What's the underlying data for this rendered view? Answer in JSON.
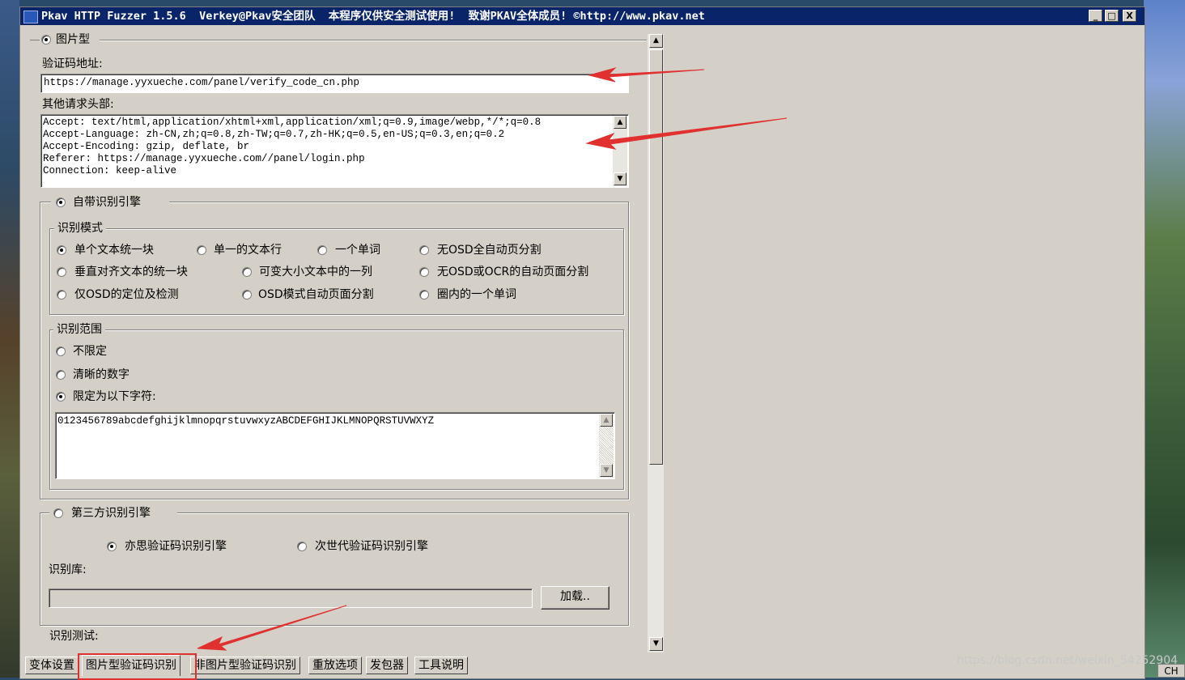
{
  "window": {
    "title": "Pkav HTTP Fuzzer 1.5.6  Verkey@Pkav安全团队  本程序仅供安全测试使用!  致谢PKAV全体成员! ©http://www.pkav.net",
    "min": "_",
    "max": "□",
    "close": "X"
  },
  "image_type": {
    "label": "图片型",
    "selected": true
  },
  "captcha_url": {
    "label": "验证码地址:",
    "value": "https://manage.yyxueche.com/panel/verify_code_cn.php"
  },
  "headers": {
    "label": "其他请求头部:",
    "lines": [
      "Accept: text/html,application/xhtml+xml,application/xml;q=0.9,image/webp,*/*;q=0.8",
      "Accept-Language: zh-CN,zh;q=0.8,zh-TW;q=0.7,zh-HK;q=0.5,en-US;q=0.3,en;q=0.2",
      "Accept-Encoding: gzip, deflate, br",
      "Referer: https://manage.yyxueche.com//panel/login.php",
      "Connection: keep-alive"
    ]
  },
  "builtin_engine": {
    "label": "自带识别引擎",
    "selected": true
  },
  "mode": {
    "legend": "识别模式",
    "options": [
      {
        "label": "单个文本统一块",
        "selected": true
      },
      {
        "label": "单一的文本行",
        "selected": false
      },
      {
        "label": "一个单词",
        "selected": false
      },
      {
        "label": "无OSD全自动页分割",
        "selected": false
      },
      {
        "label": "垂直对齐文本的统一块",
        "selected": false
      },
      {
        "label": "可变大小文本中的一列",
        "selected": false
      },
      {
        "label": "无OSD或OCR的自动页面分割",
        "selected": false
      },
      {
        "label": "仅OSD的定位及检测",
        "selected": false
      },
      {
        "label": "OSD模式自动页面分割",
        "selected": false
      },
      {
        "label": "圈内的一个单词",
        "selected": false
      }
    ]
  },
  "range": {
    "legend": "识别范围",
    "options": [
      {
        "label": "不限定",
        "selected": false
      },
      {
        "label": "清晰的数字",
        "selected": false
      },
      {
        "label": "限定为以下字符:",
        "selected": true
      }
    ],
    "chars": "0123456789abcdefghijklmnopqrstuvwxyzABCDEFGHIJKLMNOPQRSTUVWXYZ"
  },
  "third_party": {
    "label": "第三方识别引擎",
    "selected": false,
    "engines": [
      {
        "label": "亦思验证码识别引擎",
        "selected": true
      },
      {
        "label": "次世代验证码识别引擎",
        "selected": false
      }
    ],
    "lib_label": "识别库:",
    "lib_value": "",
    "load_button": "加载.."
  },
  "test_label": "识别测试:",
  "tabs": [
    "变体设置",
    "图片型验证码识别",
    "非图片型验证码识别",
    "重放选项",
    "发包器",
    "工具说明"
  ],
  "active_tab": 1,
  "watermark": "https://blog.csdn.net/weixin_54252904",
  "ime": "CH",
  "colors": {
    "title_bg": "#0a246a",
    "face": "#d4d0c8",
    "annotation": "#e03030"
  }
}
